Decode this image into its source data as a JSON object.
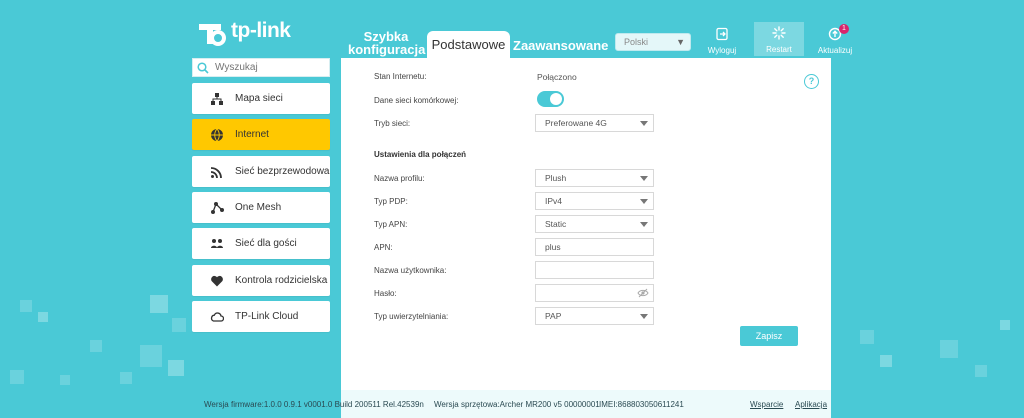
{
  "header": {
    "brand": "tp-link",
    "tabs": [
      {
        "label": "Szybka konfiguracja"
      },
      {
        "label": "Podstawowe"
      },
      {
        "label": "Zaawansowane"
      }
    ],
    "language": "Polski",
    "tools": {
      "logout": "Wyloguj",
      "restart": "Restart",
      "update": "Aktualizuj",
      "update_badge": "1"
    }
  },
  "sidebar": {
    "search_placeholder": "Wyszukaj",
    "items": [
      {
        "label": "Mapa sieci",
        "icon": "network-map-icon"
      },
      {
        "label": "Internet",
        "icon": "globe-icon",
        "active": true
      },
      {
        "label": "Sieć bezprzewodowa",
        "icon": "wifi-icon"
      },
      {
        "label": "One Mesh",
        "icon": "mesh-icon"
      },
      {
        "label": "Sieć dla gości",
        "icon": "guests-icon"
      },
      {
        "label": "Kontrola rodzicielska",
        "icon": "heart-icon"
      },
      {
        "label": "TP-Link Cloud",
        "icon": "cloud-icon"
      }
    ]
  },
  "main": {
    "internet_status_label": "Stan Internetu:",
    "internet_status_value": "Połączono",
    "mobile_data_label": "Dane sieci komórkowej:",
    "mobile_data_on": true,
    "network_mode_label": "Tryb sieci:",
    "network_mode_value": "Preferowane 4G",
    "section_title": "Ustawienia dla połączeń",
    "profile_name_label": "Nazwa profilu:",
    "profile_name_value": "Plush",
    "pdp_type_label": "Typ PDP:",
    "pdp_type_value": "IPv4",
    "apn_type_label": "Typ APN:",
    "apn_type_value": "Static",
    "apn_label": "APN:",
    "apn_value": "plus",
    "username_label": "Nazwa użytkownika:",
    "username_value": "",
    "password_label": "Hasło:",
    "password_value": "",
    "auth_type_label": "Typ uwierzytelniania:",
    "auth_type_value": "PAP",
    "save_label": "Zapisz",
    "help_symbol": "?"
  },
  "footer": {
    "firmware": "Wersja firmware:1.0.0 0.9.1 v0001.0 Build 200511 Rel.42539n",
    "hardware": "Wersja sprzętowa:Archer MR200 v5 00000001",
    "imei": "IMEI:868803050611241",
    "support": "Wsparcie",
    "app": "Aplikacja"
  },
  "colors": {
    "background": "#4ac9d6",
    "active_nav": "#ffc800",
    "accent": "#4ac9d6",
    "badge": "#d9256c"
  }
}
